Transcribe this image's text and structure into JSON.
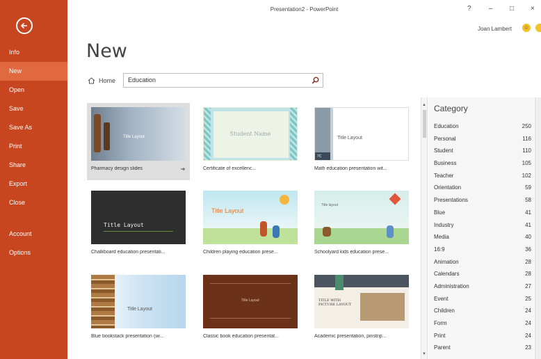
{
  "window": {
    "title": "Presentation2 - PowerPoint",
    "help": "?",
    "minimize": "–",
    "maximize": "□",
    "close": "×"
  },
  "user": {
    "name": "Joan Lambert"
  },
  "sidebar": {
    "items": [
      {
        "label": "Info"
      },
      {
        "label": "New",
        "active": true
      },
      {
        "label": "Open"
      },
      {
        "label": "Save"
      },
      {
        "label": "Save As"
      },
      {
        "label": "Print"
      },
      {
        "label": "Share"
      },
      {
        "label": "Export"
      },
      {
        "label": "Close"
      }
    ],
    "lower_items": [
      {
        "label": "Account"
      },
      {
        "label": "Options"
      }
    ]
  },
  "page": {
    "title": "New"
  },
  "search": {
    "home_label": "Home",
    "value": "Education"
  },
  "templates": [
    {
      "label": "Pharmacy design slides",
      "thumb_text": "Title Layout"
    },
    {
      "label": "Certificate of excellenc...",
      "thumb_text": "Student Name"
    },
    {
      "label": "Math education presentation wit...",
      "thumb_text": "Title Layout"
    },
    {
      "label": "Chalkboard education presentati...",
      "thumb_text": "Title Layout"
    },
    {
      "label": "Children playing education prese...",
      "thumb_text": "Title Layout"
    },
    {
      "label": "Schoolyard kids education prese...",
      "thumb_text": "Title layout"
    },
    {
      "label": "Blue bookstack presentation (wi...",
      "thumb_text": "Title Layout"
    },
    {
      "label": "Classic book education presentat...",
      "thumb_text": "Title Layout"
    },
    {
      "label": "Academic presentation, pinstrip...",
      "thumb_text": "TITLE WITH PICTURE LAYOUT"
    }
  ],
  "category": {
    "heading": "Category",
    "items": [
      {
        "name": "Education",
        "count": "250"
      },
      {
        "name": "Personal",
        "count": "116"
      },
      {
        "name": "Student",
        "count": "110"
      },
      {
        "name": "Business",
        "count": "105"
      },
      {
        "name": "Teacher",
        "count": "102"
      },
      {
        "name": "Orientation",
        "count": "59"
      },
      {
        "name": "Presentations",
        "count": "58"
      },
      {
        "name": "Blue",
        "count": "41"
      },
      {
        "name": "Industry",
        "count": "41"
      },
      {
        "name": "Media",
        "count": "40"
      },
      {
        "name": "16:9",
        "count": "36"
      },
      {
        "name": "Animation",
        "count": "28"
      },
      {
        "name": "Calendars",
        "count": "28"
      },
      {
        "name": "Administration",
        "count": "27"
      },
      {
        "name": "Event",
        "count": "25"
      },
      {
        "name": "Children",
        "count": "24"
      },
      {
        "name": "Form",
        "count": "24"
      },
      {
        "name": "Print",
        "count": "24"
      },
      {
        "name": "Parent",
        "count": "23"
      }
    ]
  },
  "colors": {
    "sidebar": "#c8461f",
    "sidebar_active": "#e0693f"
  }
}
